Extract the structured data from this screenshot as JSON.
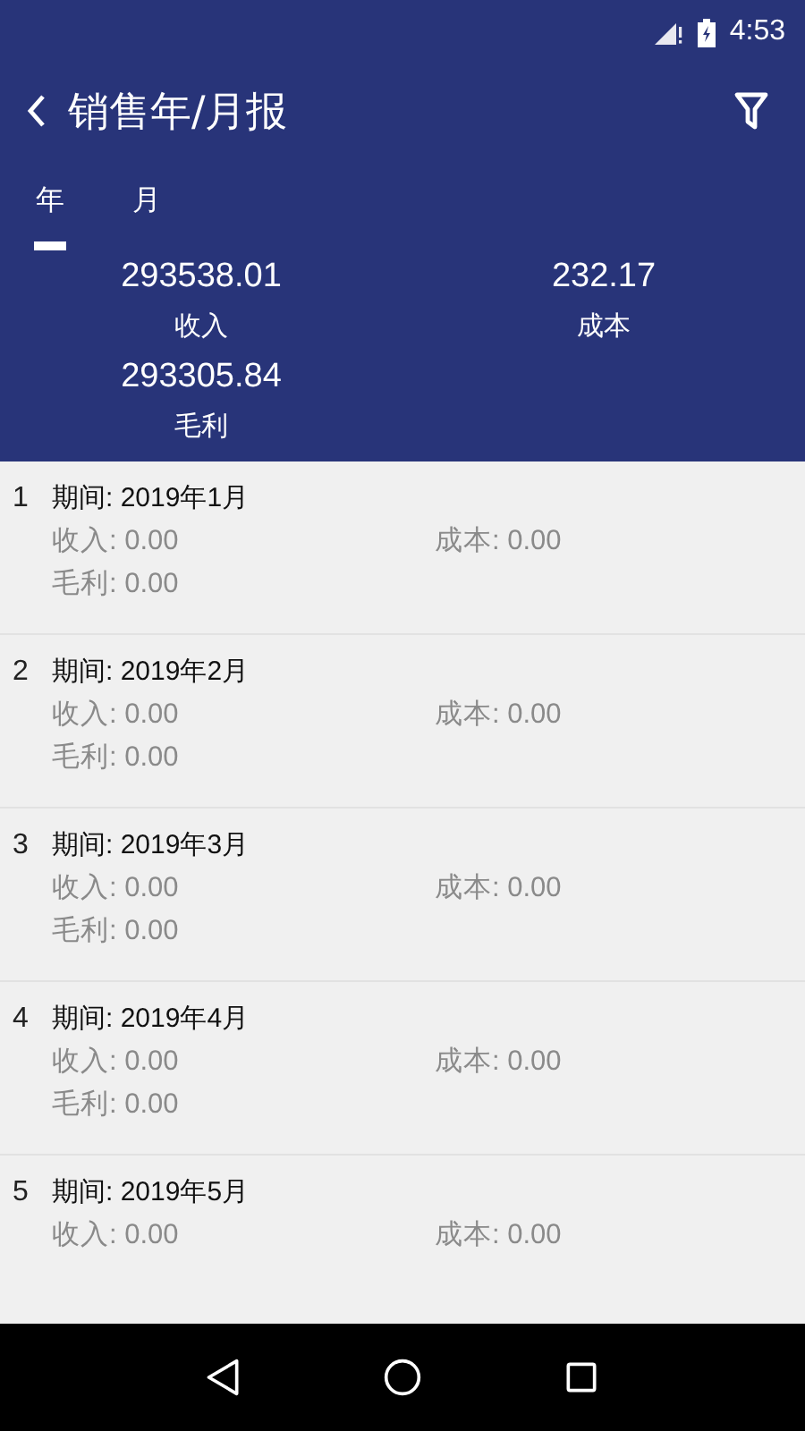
{
  "status_bar": {
    "time": "4:53"
  },
  "toolbar": {
    "title": "销售年/月报"
  },
  "tabs": [
    {
      "label": "年",
      "selected": true
    },
    {
      "label": "月",
      "selected": false
    }
  ],
  "summary": [
    {
      "value": "293538.01",
      "label": "收入"
    },
    {
      "value": "232.17",
      "label": "成本"
    },
    {
      "value": "293305.84",
      "label": "毛利"
    }
  ],
  "periods": [
    {
      "index": "1",
      "period": "期间: 2019年1月",
      "income": "收入: 0.00",
      "cost": "成本: 0.00",
      "gross": "毛利: 0.00"
    },
    {
      "index": "2",
      "period": "期间: 2019年2月",
      "income": "收入: 0.00",
      "cost": "成本: 0.00",
      "gross": "毛利: 0.00"
    },
    {
      "index": "3",
      "period": "期间: 2019年3月",
      "income": "收入: 0.00",
      "cost": "成本: 0.00",
      "gross": "毛利: 0.00"
    },
    {
      "index": "4",
      "period": "期间: 2019年4月",
      "income": "收入: 0.00",
      "cost": "成本: 0.00",
      "gross": "毛利: 0.00"
    },
    {
      "index": "5",
      "period": "期间: 2019年5月",
      "income": "收入: 0.00",
      "cost": "成本: 0.00"
    }
  ]
}
